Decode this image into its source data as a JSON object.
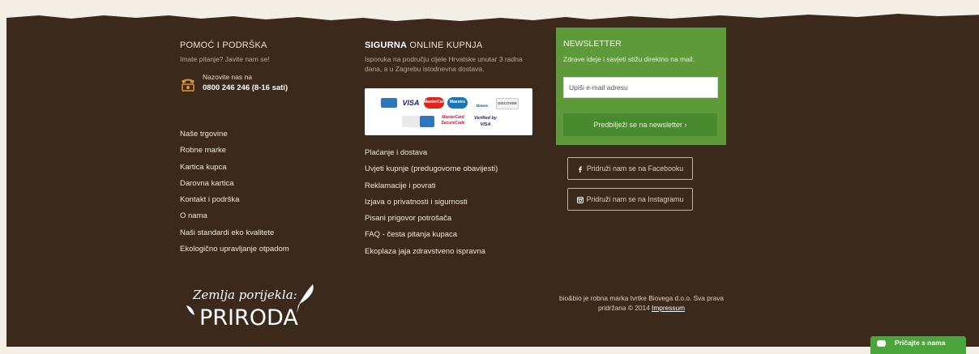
{
  "help": {
    "title": "POMOĆ I PODRŠKA",
    "subtitle": "Imate pitanje? Javite nam se!",
    "call_label": "Nazovite nas na",
    "phone": "0800 246 246 (8-16 sati)"
  },
  "links_left": [
    "Naše trgovine",
    "Robne marke",
    "Kartica kupca",
    "Darovna kartica",
    "Kontakt i podrška",
    "O nama",
    "Naši standardi eko kvalitete",
    "Ekologično upravljanje otpadom"
  ],
  "secure": {
    "title_bold": "SIGURNA",
    "title_rest": " ONLINE KUPNJA",
    "desc": "Isporuka na području cijele Hrvatske unutar 3 radna dana, a u Zagrebu istodnevna dostava."
  },
  "cards": {
    "visa": "VISA",
    "mastercard": "MasterCard",
    "maestro": "Maestro",
    "diners": "Diners Club",
    "discover": "DISCOVER",
    "mc_secure": "MasterCard SecureCode",
    "verified_visa": "Verified by VISA"
  },
  "links_middle": [
    "Plaćanje i dostava",
    "Uvjeti kupnje (predugovorne obavijesti)",
    "Reklamacije i povrati",
    "Izjava o privatnosti i sigurnosti",
    "Pisani prigovor potrošača",
    "FAQ - česta pitanja kupaca",
    "Ekoplaza jaja zdravstveno ispravna"
  ],
  "newsletter": {
    "title": "NEWSLETTER",
    "desc": "Zdrave ideje i savjeti stižu direktno na mail.",
    "placeholder": "Upiši e-mail adresu",
    "button": "Predbilježi se na newsletter ›"
  },
  "social": {
    "facebook": "Pridruži nam se na Facebooku",
    "instagram": "Pridruži nam se na Instagramu"
  },
  "logo": {
    "line1": "Zemlja porijekla:",
    "line2": "PRIRODA"
  },
  "copyright": {
    "text": "bio&bio je robna marka tvrtke Biovega d.o.o. Sva prava pridržana © 2014 ",
    "link": "Impressum"
  },
  "chat": {
    "label": "Pričajte s nama"
  },
  "colors": {
    "footer_bg": "#3b2a1b",
    "newsletter_bg": "#5e9a3a",
    "chat_bg": "#4aa53a"
  }
}
